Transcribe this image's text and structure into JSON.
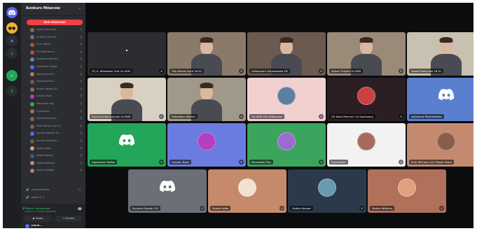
{
  "server": {
    "name": "Konkurs Mówców",
    "mentions_label": "NEW MENTIONS"
  },
  "sidebar": {
    "participants": [
      {
        "name": "Agata Skorupska",
        "color": "#8a6b4a"
      },
      {
        "name": "(A SKM) Olaf Wit...",
        "color": "#6b6f78"
      },
      {
        "name": "(P) A. Witko...",
        "color": "#9b5d3a"
      },
      {
        "name": "(P) Karol Marcz...",
        "color": "#c94141"
      },
      {
        "name": "(p)Joanna Michale...",
        "color": "#6b7cc8"
      },
      {
        "name": "Agnieszka Cieślar",
        "color": "#5865f2"
      },
      {
        "name": "Aleksandra Za...",
        "color": "#b07a5a"
      },
      {
        "name": "Aleksandra Bu...",
        "color": "#7a5c48"
      },
      {
        "name": "Antoni Trojska 1A...",
        "color": "#8e6b50"
      },
      {
        "name": "Lokalny Bard",
        "color": "#b33fc2"
      },
      {
        "name": "Marszałek Filip",
        "color": "#3ba55d"
      },
      {
        "name": "P.pechalski",
        "color": "#a86b5a"
      },
      {
        "name": "Paweł Rodzynski...",
        "color": "#7a6a5a"
      },
      {
        "name": "Piotr Michera 1IO FS...",
        "color": "#8a5c4a"
      },
      {
        "name": "Szymon Dotrek 1IO",
        "color": "#5865f2"
      },
      {
        "name": "Szymon Klemczy...",
        "color": "#6a5a4a"
      },
      {
        "name": "Sędzia Adka",
        "color": "#c9a08a"
      },
      {
        "name": "Sędzia Kacper",
        "color": "#3a5a8a"
      },
      {
        "name": "Sędzia Wiktoria",
        "color": "#c98a6a"
      },
      {
        "name": "Szakira Sobota",
        "color": "#b07a8a"
      }
    ],
    "channels": [
      {
        "name": "pozadzabiskie",
        "count": "(3)"
      },
      {
        "name": "pokój nr 3",
        "count": ""
      }
    ],
    "voice": {
      "status": "Voice Connected",
      "subtitle": "pokój nr 1 / Konkurs Mówców",
      "video_label": "Video",
      "screen_label": "Screen"
    },
    "user": {
      "name": "Jakub..."
    }
  },
  "tiles": [
    {
      "label": "(P) A. Witkowski Olaf 1A SKM",
      "type": "dark",
      "bg": "#2b2d31"
    },
    {
      "label": "Filip Michal Dura 1B IO",
      "type": "cam",
      "bg": "#8a7a6a"
    },
    {
      "label": "Aleksandra Zapotowska 1B",
      "type": "cam",
      "bg": "#6a5a50"
    },
    {
      "label": "Antoni Trojska 1A SKM",
      "type": "cam",
      "bg": "#9a8a78"
    },
    {
      "label": "Paweł Rodzynski 1B IO",
      "type": "cam",
      "bg": "#c8c0b0"
    },
    {
      "label": "Szymon Klemczynski 1a SKM",
      "type": "cam",
      "bg": "#d8d0c0"
    },
    {
      "label": "Sebastian Gabriel",
      "type": "cam",
      "bg": "#a09888"
    },
    {
      "label": "OA SKM Olaf Witkowski",
      "type": "avatar",
      "bg": "#f2d0d0",
      "accent": "#5a7fa0"
    },
    {
      "label": "(P) Karol Marczec 1A Sportowcy",
      "type": "avatar",
      "bg": "#2b1f24",
      "accent": "#c94141"
    },
    {
      "label": "(p)Joanna Michalewska",
      "type": "discord",
      "bg": "#5a7fcf"
    },
    {
      "label": "Agnieszka Cieślar",
      "type": "discord",
      "bg": "#23a55a"
    },
    {
      "label": "Lokalny Bard",
      "type": "avatar",
      "bg": "#6b7ce0",
      "accent": "#b33fc2"
    },
    {
      "label": "Marszałek Filip",
      "type": "avatar",
      "bg": "#3ba55d",
      "accent": "#9a6cd0"
    },
    {
      "label": "P.pechalski",
      "type": "avatar",
      "bg": "#f2f2f2",
      "accent": "#a86b5a"
    },
    {
      "label": "Piotr Michera 1IO Filosek Team",
      "type": "avatar",
      "bg": "#c48a70",
      "accent": "#8a5c4a"
    },
    {
      "label": "Szymon Dotrek 1IO",
      "type": "discord",
      "bg": "#6b6f78"
    },
    {
      "label": "Sędzia Adka",
      "type": "avatar",
      "bg": "#c48a6a",
      "accent": "#f2e0d0"
    },
    {
      "label": "Sędzia Kacper",
      "type": "avatar",
      "bg": "#2b3a4a",
      "accent": "#6a9ab0"
    },
    {
      "label": "Sędzia Wiktoria",
      "type": "avatar",
      "bg": "#b0705a",
      "accent": "#e0a080"
    }
  ]
}
